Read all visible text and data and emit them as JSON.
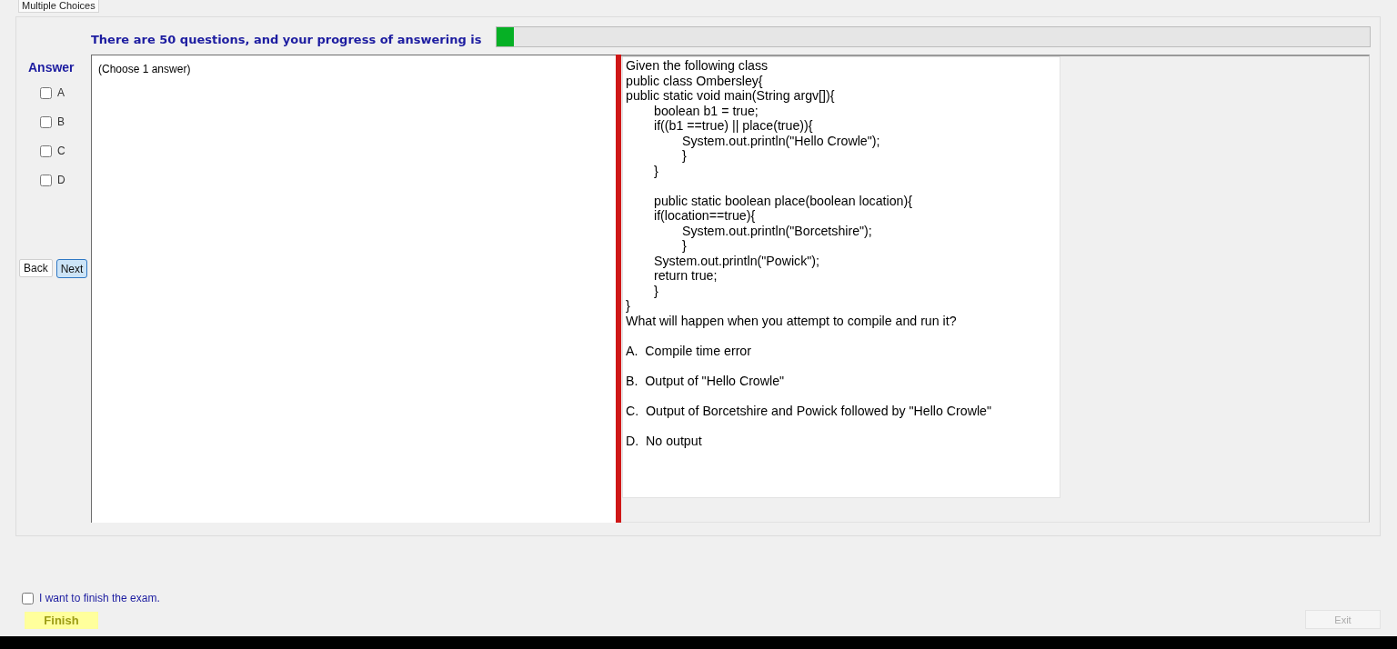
{
  "tab": {
    "label": "Multiple Choices"
  },
  "header": {
    "text": "There are 50 questions, and your progress of answering is",
    "progress": {
      "level": 0.02
    }
  },
  "answer_panel": {
    "title": "Answer",
    "options": [
      {
        "label": "A",
        "checked": false
      },
      {
        "label": "B",
        "checked": false
      },
      {
        "label": "C",
        "checked": false
      },
      {
        "label": "D",
        "checked": false
      }
    ],
    "buttons": [
      {
        "label": "Back",
        "focused": false
      },
      {
        "label": "Next",
        "focused": true
      }
    ]
  },
  "answer_box": {
    "instruction": "(Choose 1 answer)"
  },
  "question": {
    "intro": "Given the following class",
    "code": "public class Ombersley{\npublic static void main(String argv[]){\n\tboolean b1 = true;\n\tif((b1 ==true) || place(true)){\n\t\tSystem.out.println(\"Hello Crowle\");\n\t\t}\n\t}\n\n\tpublic static boolean place(boolean location){\n\tif(location==true){\n\t\tSystem.out.println(\"Borcetshire\");\n\t\t}\n\tSystem.out.println(\"Powick\");\n\treturn true;\n\t}\n}",
    "prompt": "What will happen when you attempt to compile and run it?",
    "choices": [
      "A.  Compile time error",
      "B.  Output of \"Hello Crowle\"",
      "C.  Output of Borcetshire and Powick followed by \"Hello Crowle\"",
      "D.  No output"
    ]
  },
  "finish": {
    "label": "I want to finish the exam.",
    "checked": false,
    "button": "Finish"
  },
  "exit_button": {
    "label": "Exit",
    "disabled": true
  }
}
